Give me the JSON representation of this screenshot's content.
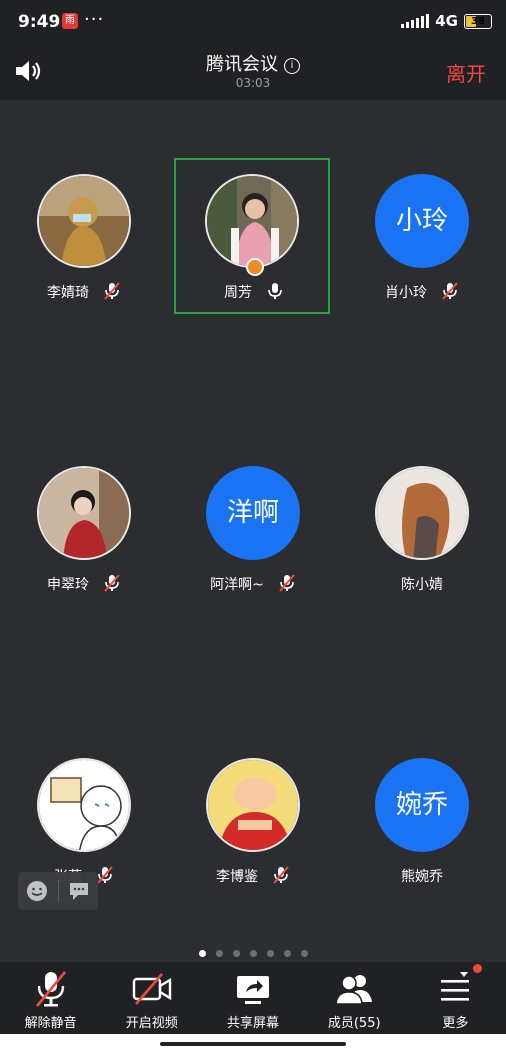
{
  "status_bar": {
    "time": "9:49",
    "app_badge": "雨",
    "dots": "···",
    "network": "4G",
    "battery": "38"
  },
  "header": {
    "title": "腾讯会议",
    "info_icon": "i",
    "timer": "03:03",
    "leave_label": "离开"
  },
  "participants": [
    {
      "name": "李婧琦",
      "avatar_type": "photo",
      "muted": true
    },
    {
      "name": "周芳",
      "avatar_type": "photo",
      "muted": false,
      "active_speaker": true,
      "host": true
    },
    {
      "name": "肖小玲",
      "avatar_type": "text",
      "avatar_text": "小玲",
      "muted": true
    },
    {
      "name": "申翠玲",
      "avatar_type": "photo",
      "muted": true
    },
    {
      "name": "阿洋啊~",
      "avatar_type": "text",
      "avatar_text": "洋啊",
      "muted": true
    },
    {
      "name": "陈小婧",
      "avatar_type": "photo",
      "muted": false
    },
    {
      "name": "张荣",
      "avatar_type": "photo",
      "muted": true
    },
    {
      "name": "李博鉴",
      "avatar_type": "photo",
      "muted": true
    },
    {
      "name": "熊婉乔",
      "avatar_type": "text",
      "avatar_text": "婉乔",
      "muted": false
    }
  ],
  "pager": {
    "pages": 7,
    "current": 1
  },
  "toolbar": {
    "unmute": "解除静音",
    "video": "开启视频",
    "share": "共享屏幕",
    "members": "成员(55)",
    "more": "更多"
  },
  "colors": {
    "accent": "#1a73f2",
    "leave": "#f0493e",
    "active_border": "#2ea043",
    "background": "#2b2d30"
  }
}
